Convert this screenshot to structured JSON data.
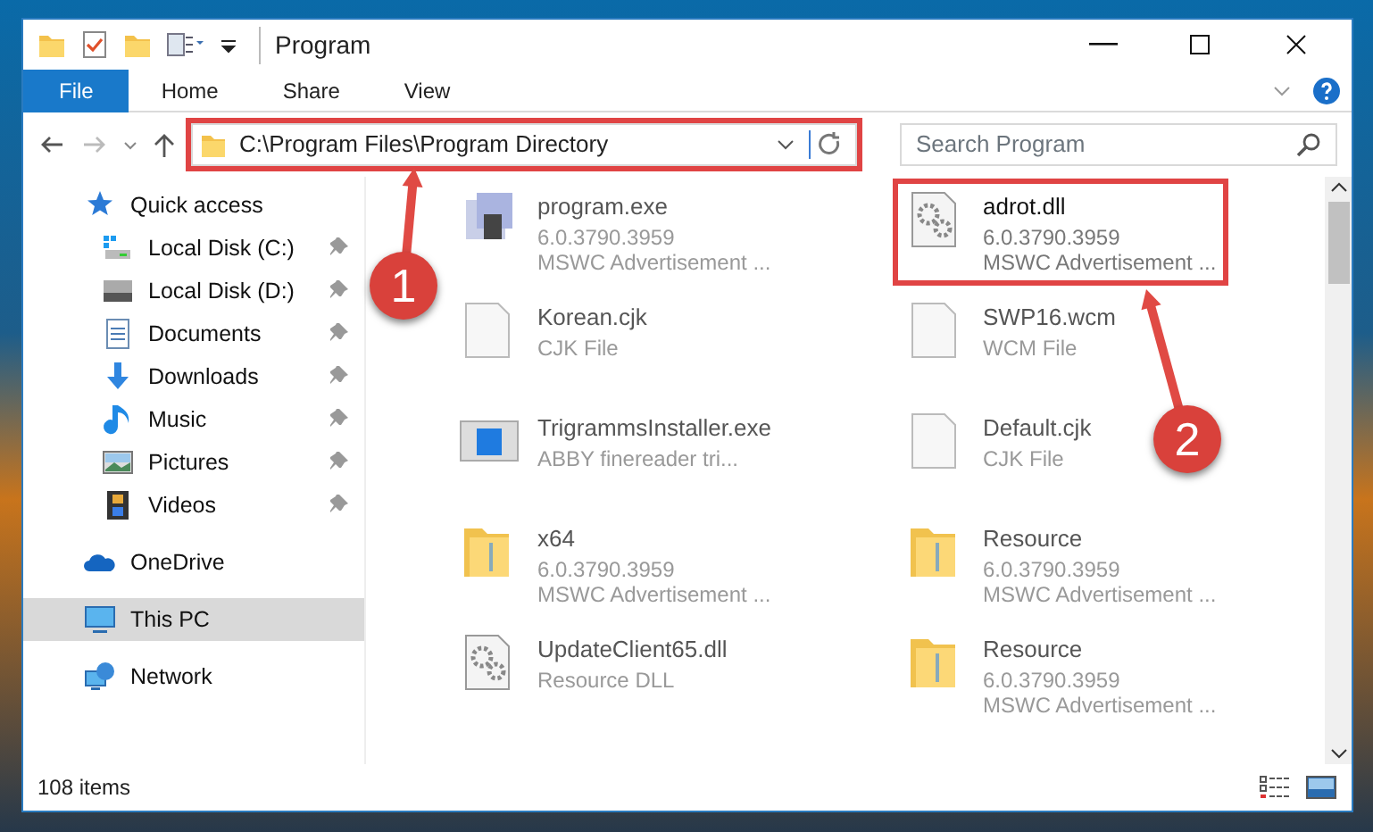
{
  "window": {
    "title": "Program"
  },
  "ribbon_tabs": [
    {
      "label": "File",
      "selected": true
    },
    {
      "label": "Home",
      "selected": false
    },
    {
      "label": "Share",
      "selected": false
    },
    {
      "label": "View",
      "selected": false
    }
  ],
  "address_bar": {
    "path": "C:\\Program Files\\Program Directory",
    "highlighted": true
  },
  "search": {
    "placeholder": "Search Program"
  },
  "sidebar": {
    "items": [
      {
        "label": "Quick access",
        "kind": "star",
        "pinned": false,
        "selected": false,
        "children": [
          {
            "label": "Local Disk (C:)",
            "kind": "windrive",
            "pinned": true,
            "selected": false
          },
          {
            "label": "Local Disk (D:)",
            "kind": "drive",
            "pinned": true,
            "selected": false
          },
          {
            "label": "Documents",
            "kind": "docs",
            "pinned": true,
            "selected": false
          },
          {
            "label": "Downloads",
            "kind": "download",
            "pinned": true,
            "selected": false
          },
          {
            "label": "Music",
            "kind": "music",
            "pinned": true,
            "selected": false
          },
          {
            "label": "Pictures",
            "kind": "pictures",
            "pinned": true,
            "selected": false
          },
          {
            "label": "Videos",
            "kind": "videos",
            "pinned": true,
            "selected": false
          }
        ]
      },
      {
        "label": "OneDrive",
        "kind": "cloud",
        "pinned": false,
        "selected": false
      },
      {
        "label": "This PC",
        "kind": "pc",
        "pinned": false,
        "selected": true
      },
      {
        "label": "Network",
        "kind": "network",
        "pinned": false,
        "selected": false
      }
    ]
  },
  "files": [
    {
      "name": "program.exe",
      "kind": "app",
      "details": [
        "6.0.3790.3959",
        "MSWC Advertisement ..."
      ],
      "highlighted": false
    },
    {
      "name": "adrot.dll",
      "kind": "gear",
      "details": [
        "6.0.3790.3959",
        "MSWC Advertisement ..."
      ],
      "highlighted": true
    },
    {
      "name": "Korean.cjk",
      "kind": "blank",
      "details": [
        "CJK File"
      ],
      "highlighted": false
    },
    {
      "name": "SWP16.wcm",
      "kind": "blank",
      "details": [
        "WCM File"
      ],
      "highlighted": false
    },
    {
      "name": "TrigrammsInstaller.exe",
      "kind": "window",
      "details": [
        "ABBY finereader tri..."
      ],
      "highlighted": false
    },
    {
      "name": "Default.cjk",
      "kind": "blank",
      "details": [
        "CJK File"
      ],
      "highlighted": false
    },
    {
      "name": "x64",
      "kind": "folder",
      "details": [
        "6.0.3790.3959",
        "MSWC Advertisement ..."
      ],
      "highlighted": false
    },
    {
      "name": "Resource",
      "kind": "folder",
      "details": [
        "6.0.3790.3959",
        "MSWC Advertisement ..."
      ],
      "highlighted": false
    },
    {
      "name": "UpdateClient65.dll",
      "kind": "gear",
      "details": [
        "Resource DLL"
      ],
      "highlighted": false
    },
    {
      "name": "Resource",
      "kind": "folder",
      "details": [
        "6.0.3790.3959",
        "MSWC Advertisement ..."
      ],
      "highlighted": false
    }
  ],
  "callouts": [
    {
      "label": "1"
    },
    {
      "label": "2"
    }
  ],
  "status_bar": {
    "count": "108 items"
  }
}
